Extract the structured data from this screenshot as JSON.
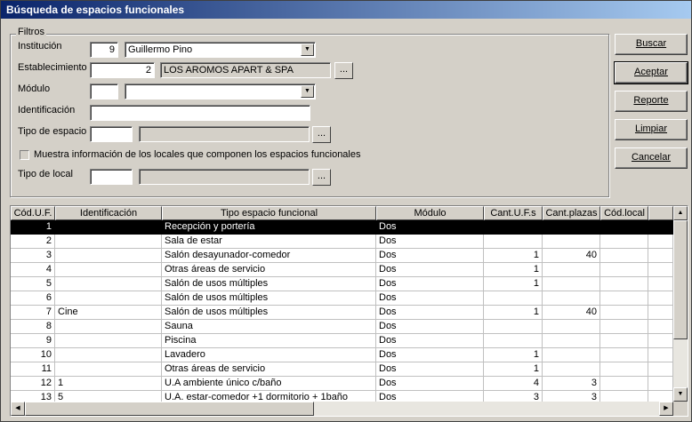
{
  "window": {
    "title": "Búsqueda de espacios funcionales"
  },
  "filters": {
    "legend": "Filtros",
    "institucion": {
      "label": "Institución",
      "code": "9",
      "name": "Guillermo Pino"
    },
    "establecimiento": {
      "label": "Establecimiento",
      "code": "2",
      "name": "LOS AROMOS APART & SPA"
    },
    "modulo": {
      "label": "Módulo",
      "code": "",
      "name": ""
    },
    "identificacion": {
      "label": "Identificación",
      "value": ""
    },
    "tipo_espacio": {
      "label": "Tipo de espacio",
      "code": "",
      "name": ""
    },
    "show_locales": {
      "label": "Muestra información de los locales que componen los espacios funcionales",
      "checked": false
    },
    "tipo_local": {
      "label": "Tipo de local",
      "code": "",
      "name": ""
    },
    "browse_glyph": "..."
  },
  "buttons": {
    "buscar": "Buscar",
    "aceptar": "Aceptar",
    "reporte": "Reporte",
    "limpiar": "Limpiar",
    "cancelar": "Cancelar"
  },
  "table": {
    "columns": [
      "Cód.U.F.",
      "Identificación",
      "Tipo espacio funcional",
      "Módulo",
      "Cant.U.F.s",
      "Cant.plazas",
      "Cód.local"
    ],
    "selected_index": 0,
    "rows": [
      [
        "1",
        "",
        "Recepción y portería",
        "Dos",
        "",
        "",
        ""
      ],
      [
        "2",
        "",
        "Sala de estar",
        "Dos",
        "",
        "",
        ""
      ],
      [
        "3",
        "",
        "Salón desayunador-comedor",
        "Dos",
        "1",
        "40",
        ""
      ],
      [
        "4",
        "",
        "Otras áreas de servicio",
        "Dos",
        "1",
        "",
        ""
      ],
      [
        "5",
        "",
        "Salón de usos múltiples",
        "Dos",
        "1",
        "",
        ""
      ],
      [
        "6",
        "",
        "Salón de usos múltiples",
        "Dos",
        "",
        "",
        ""
      ],
      [
        "7",
        "Cine",
        "Salón de usos múltiples",
        "Dos",
        "1",
        "40",
        ""
      ],
      [
        "8",
        "",
        "Sauna",
        "Dos",
        "",
        "",
        ""
      ],
      [
        "9",
        "",
        "Piscina",
        "Dos",
        "",
        "",
        ""
      ],
      [
        "10",
        "",
        "Lavadero",
        "Dos",
        "1",
        "",
        ""
      ],
      [
        "11",
        "",
        "Otras áreas de servicio",
        "Dos",
        "1",
        "",
        ""
      ],
      [
        "12",
        "1",
        "U.A ambiente único c/baño",
        "Dos",
        "4",
        "3",
        ""
      ],
      [
        "13",
        "5",
        "U.A. estar-comedor +1 dormitorio + 1baño",
        "Dos",
        "3",
        "3",
        ""
      ]
    ]
  }
}
